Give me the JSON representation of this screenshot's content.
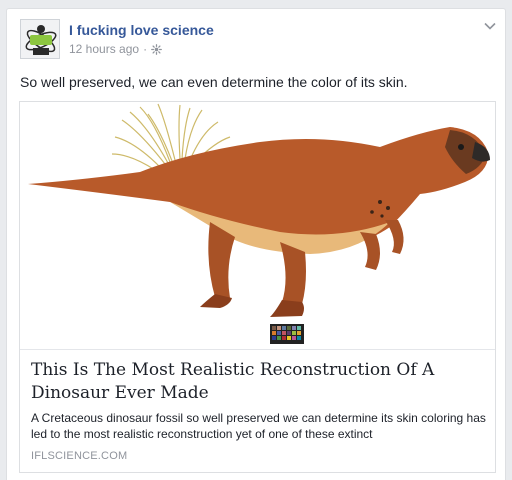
{
  "post": {
    "page_name": "I fucking love science",
    "timestamp": "12 hours ago",
    "separator": "·",
    "privacy_icon": "globe-icon",
    "menu_icon": "chevron-down-icon",
    "avatar_icon": "science-logo-icon",
    "text": "So well preserved, we can even determine the color of its skin."
  },
  "link": {
    "image_icon": "dinosaur-illustration",
    "title": "This Is The Most Realistic Reconstruction Of A Dinosaur Ever Made",
    "description": "A Cretaceous dinosaur fossil so well preserved we can determine its skin coloring has led to the most realistic reconstruction yet of one of these extinct",
    "domain": "IFLSCIENCE.COM"
  },
  "colors": {
    "name_link": "#365899",
    "meta_gray": "#90949c",
    "body_text": "#1d2129",
    "border": "#dddfe2",
    "background": "#e9ebee"
  }
}
